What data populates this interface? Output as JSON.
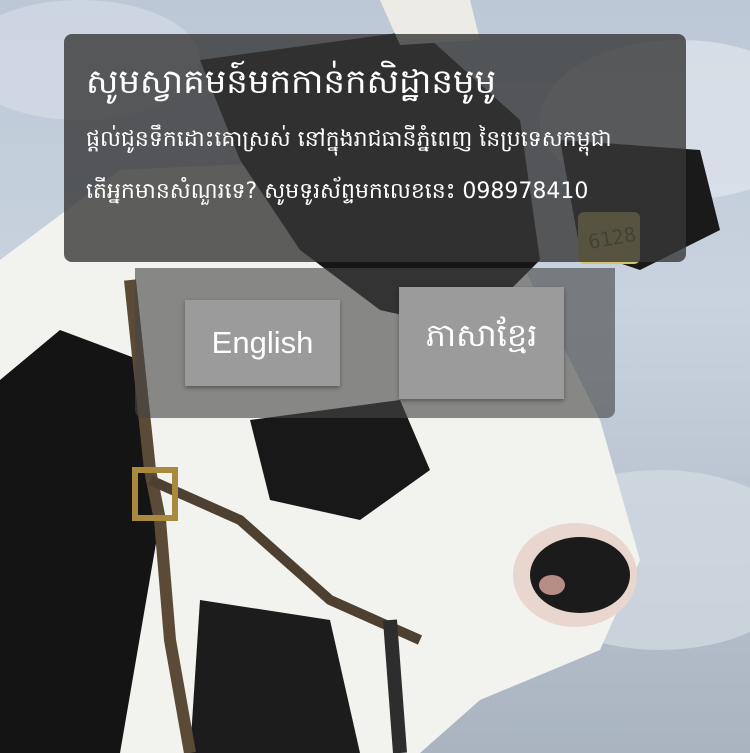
{
  "welcome": {
    "title": "សូមស្វាគមន៍មកកាន់កសិដ្ឋានមូមូ",
    "service_text": "ផ្តល់ជូនទឹកដោះគោស្រស់ នៅក្នុងរាជធានីភ្នំពេញ នៃប្រទេសកម្ពុជា",
    "contact_text": "តើអ្នកមានសំណួរទេ? សូមទូរស័ព្ទមកលេខនេះ 098978410"
  },
  "language": {
    "english_label": "English",
    "khmer_label": "ភាសាខ្មែរ"
  },
  "background": {
    "ear_tag_text": "6128"
  },
  "colors": {
    "panel": "#373737",
    "button": "#9b9b9b",
    "text": "#ffffff"
  }
}
